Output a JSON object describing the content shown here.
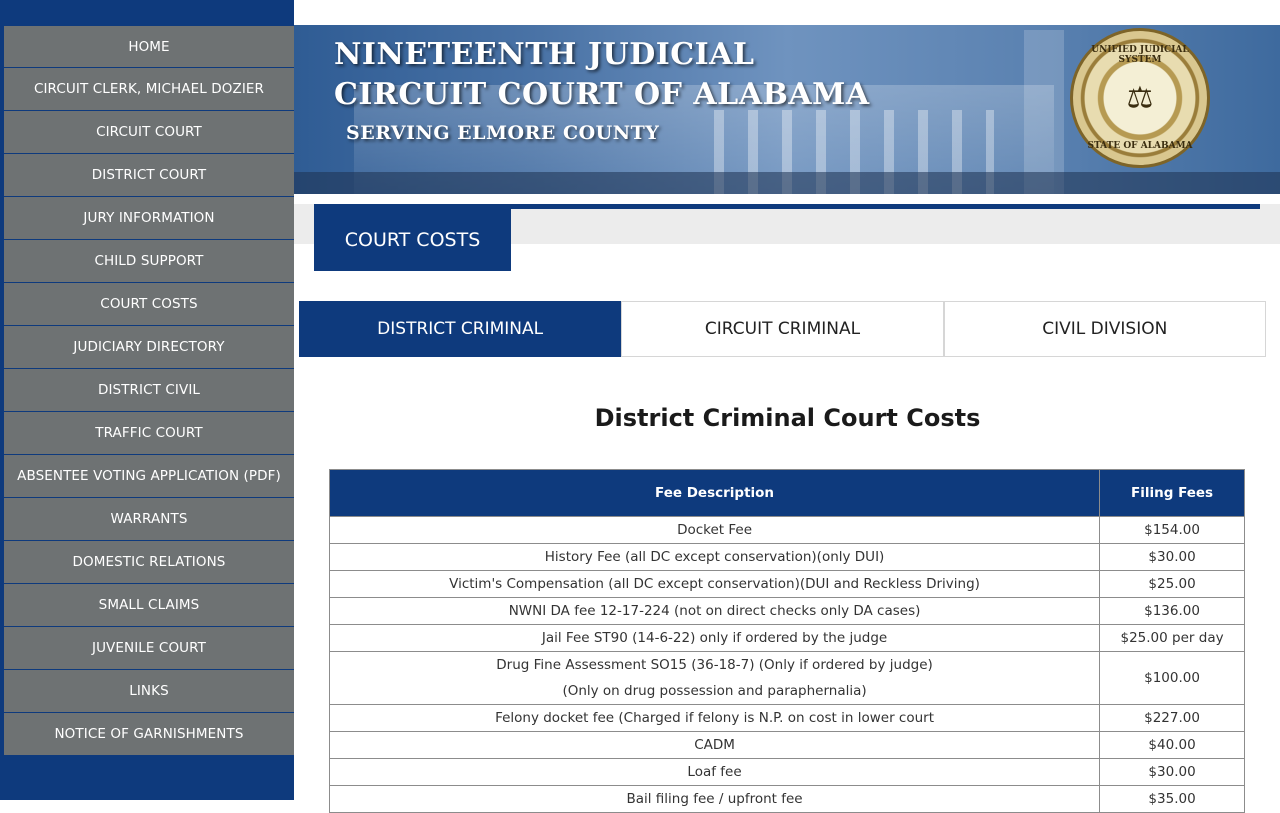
{
  "sidebar": {
    "items": [
      {
        "label": "HOME"
      },
      {
        "label": "CIRCUIT CLERK, MICHAEL DOZIER"
      },
      {
        "label": "CIRCUIT COURT"
      },
      {
        "label": "DISTRICT COURT"
      },
      {
        "label": "JURY INFORMATION"
      },
      {
        "label": "CHILD SUPPORT"
      },
      {
        "label": "COURT COSTS"
      },
      {
        "label": "JUDICIARY DIRECTORY"
      },
      {
        "label": "DISTRICT CIVIL"
      },
      {
        "label": "TRAFFIC COURT"
      },
      {
        "label": "ABSENTEE VOTING APPLICATION (PDF)"
      },
      {
        "label": "WARRANTS"
      },
      {
        "label": "DOMESTIC RELATIONS"
      },
      {
        "label": "SMALL CLAIMS"
      },
      {
        "label": "JUVENILE COURT"
      },
      {
        "label": "LINKS"
      },
      {
        "label": "NOTICE OF GARNISHMENTS"
      }
    ]
  },
  "header": {
    "line1": "NINETEENTH JUDICIAL",
    "line2": "CIRCUIT COURT OF ALABAMA",
    "line3": "SERVING ELMORE COUNTY",
    "seal_top": "UNIFIED JUDICIAL SYSTEM",
    "seal_bottom": "STATE OF ALABAMA",
    "seal_icon": "scales-of-justice-icon"
  },
  "section": {
    "title": "COURT COSTS"
  },
  "tabs": [
    {
      "label": "DISTRICT CRIMINAL",
      "active": true
    },
    {
      "label": "CIRCUIT CRIMINAL",
      "active": false
    },
    {
      "label": "CIVIL DIVISION",
      "active": false
    }
  ],
  "content": {
    "title": "District Criminal Court Costs",
    "table": {
      "headers": [
        "Fee Description",
        "Filing Fees"
      ],
      "rows": [
        {
          "desc": "Docket Fee",
          "amount": "$154.00"
        },
        {
          "desc": "History Fee (all DC except conservation)(only DUI)",
          "amount": "$30.00"
        },
        {
          "desc": "Victim's Compensation (all DC except conservation)(DUI and Reckless Driving)",
          "amount": "$25.00"
        },
        {
          "desc": "NWNI DA fee 12-17-224 (not on direct checks only DA cases)",
          "amount": "$136.00"
        },
        {
          "desc": "Jail Fee ST90 (14-6-22) only if ordered by the judge",
          "amount": "$25.00 per day"
        },
        {
          "desc": "Drug Fine Assessment SO15 (36-18-7) (Only if ordered by judge)",
          "desc2": "(Only on drug possession and paraphernalia)",
          "amount": "$100.00"
        },
        {
          "desc": "Felony docket fee (Charged if felony is N.P. on cost in lower court",
          "amount": "$227.00"
        },
        {
          "desc": "CADM",
          "amount": "$40.00"
        },
        {
          "desc": "Loaf fee",
          "amount": "$30.00"
        },
        {
          "desc": "Bail filing fee / upfront fee",
          "amount": "$35.00"
        }
      ]
    }
  },
  "colors": {
    "primary": "#0e3a7d",
    "nav_bg": "#6e7273",
    "band": "#ececec"
  }
}
